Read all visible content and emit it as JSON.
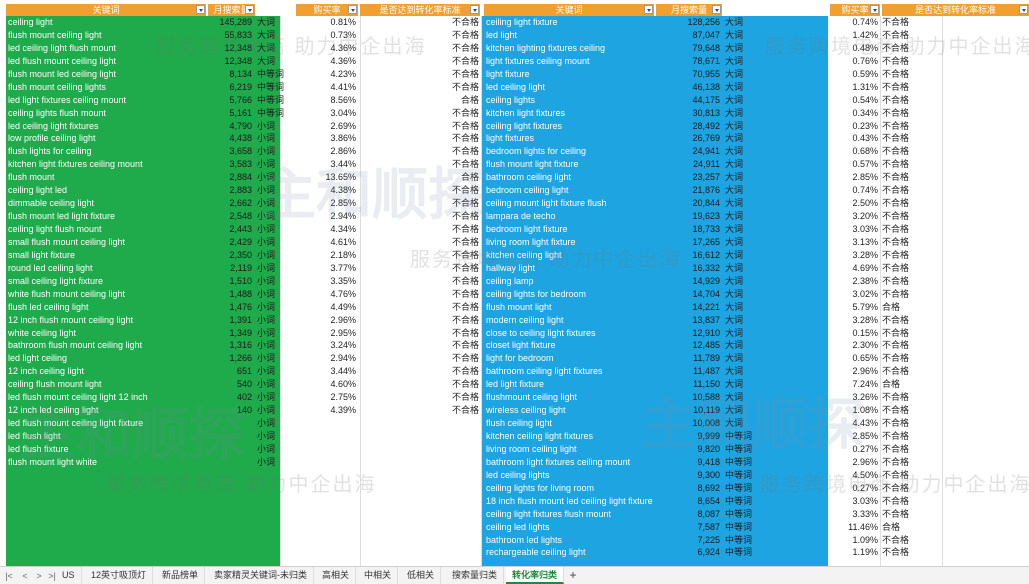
{
  "headers": {
    "keyword": "关键词",
    "monthly_search": "月搜索量",
    "purchase_rate": "购买率",
    "meets_standard": "是否达到转化率标准",
    "keyword_right": "关键词",
    "monthly_search_right": "月搜索量",
    "purchase_rate_right": "购买率",
    "meets_standard_right": "是否达到转化率标准"
  },
  "left_rows": [
    {
      "keyword": "ceiling light",
      "volume": "145,289",
      "category": "大词"
    },
    {
      "keyword": "flush mount ceiling light",
      "volume": "55,833",
      "category": "大词"
    },
    {
      "keyword": "led ceiling light flush mount",
      "volume": "12,348",
      "category": "大词"
    },
    {
      "keyword": "led flush mount ceiling light",
      "volume": "12,348",
      "category": "大词"
    },
    {
      "keyword": "flush mount led ceiling light",
      "volume": "8,134",
      "category": "中等词"
    },
    {
      "keyword": "flush mount ceiling lights",
      "volume": "6,219",
      "category": "中等词"
    },
    {
      "keyword": "led light fixtures ceiling mount",
      "volume": "5,766",
      "category": "中等词"
    },
    {
      "keyword": "ceiling lights flush mount",
      "volume": "5,161",
      "category": "中等词"
    },
    {
      "keyword": "led ceiling light fixtures",
      "volume": "4,790",
      "category": "小词"
    },
    {
      "keyword": "low profile ceiling light",
      "volume": "4,438",
      "category": "小词"
    },
    {
      "keyword": "flush lights for ceiling",
      "volume": "3,658",
      "category": "小词"
    },
    {
      "keyword": "kitchen light fixtures ceiling mount",
      "volume": "3,583",
      "category": "小词"
    },
    {
      "keyword": "flush mount",
      "volume": "2,884",
      "category": "小词"
    },
    {
      "keyword": "ceiling light led",
      "volume": "2,883",
      "category": "小词"
    },
    {
      "keyword": "dimmable ceiling light",
      "volume": "2,662",
      "category": "小词"
    },
    {
      "keyword": "flush mount led light fixture",
      "volume": "2,548",
      "category": "小词"
    },
    {
      "keyword": "ceiling light flush mount",
      "volume": "2,443",
      "category": "小词"
    },
    {
      "keyword": "small flush mount ceiling light",
      "volume": "2,429",
      "category": "小词"
    },
    {
      "keyword": "small light fixture",
      "volume": "2,350",
      "category": "小词"
    },
    {
      "keyword": "round led ceiling light",
      "volume": "2,119",
      "category": "小词"
    },
    {
      "keyword": "small ceiling light fixture",
      "volume": "1,510",
      "category": "小词"
    },
    {
      "keyword": "white flush mount ceiling light",
      "volume": "1,488",
      "category": "小词"
    },
    {
      "keyword": "flush led ceiling light",
      "volume": "1,476",
      "category": "小词"
    },
    {
      "keyword": "12 inch flush mount ceiling light",
      "volume": "1,391",
      "category": "小词"
    },
    {
      "keyword": "white ceiling light",
      "volume": "1,349",
      "category": "小词"
    },
    {
      "keyword": "bathroom flush mount ceiling light",
      "volume": "1,316",
      "category": "小词"
    },
    {
      "keyword": "led light ceiling",
      "volume": "1,266",
      "category": "小词"
    },
    {
      "keyword": "12 inch ceiling light",
      "volume": "651",
      "category": "小词"
    },
    {
      "keyword": "ceiling flush mount light",
      "volume": "540",
      "category": "小词"
    },
    {
      "keyword": "led flush mount ceiling light 12 inch",
      "volume": "402",
      "category": "小词"
    },
    {
      "keyword": "12 inch led ceiling light",
      "volume": "140",
      "category": "小词"
    },
    {
      "keyword": "led flush mount ceiling light fixture",
      "volume": "",
      "category": "小词"
    },
    {
      "keyword": "led flush light",
      "volume": "",
      "category": "小词"
    },
    {
      "keyword": "led flush fixture",
      "volume": "",
      "category": "小词"
    },
    {
      "keyword": "flush mount light white",
      "volume": "",
      "category": "小词"
    }
  ],
  "left_rates": [
    {
      "rate": "0.81%",
      "status": "不合格"
    },
    {
      "rate": "0.73%",
      "status": "不合格"
    },
    {
      "rate": "4.36%",
      "status": "不合格"
    },
    {
      "rate": "4.36%",
      "status": "不合格"
    },
    {
      "rate": "4.23%",
      "status": "不合格"
    },
    {
      "rate": "4.41%",
      "status": "不合格"
    },
    {
      "rate": "8.56%",
      "status": "合格"
    },
    {
      "rate": "3.04%",
      "status": "不合格"
    },
    {
      "rate": "2.69%",
      "status": "不合格"
    },
    {
      "rate": "3.86%",
      "status": "不合格"
    },
    {
      "rate": "2.86%",
      "status": "不合格"
    },
    {
      "rate": "3.44%",
      "status": "不合格"
    },
    {
      "rate": "13.65%",
      "status": "合格"
    },
    {
      "rate": "4.38%",
      "status": "不合格"
    },
    {
      "rate": "2.85%",
      "status": "不合格"
    },
    {
      "rate": "2.94%",
      "status": "不合格"
    },
    {
      "rate": "4.34%",
      "status": "不合格"
    },
    {
      "rate": "4.61%",
      "status": "不合格"
    },
    {
      "rate": "2.18%",
      "status": "不合格"
    },
    {
      "rate": "3.77%",
      "status": "不合格"
    },
    {
      "rate": "3.35%",
      "status": "不合格"
    },
    {
      "rate": "4.76%",
      "status": "不合格"
    },
    {
      "rate": "4.49%",
      "status": "不合格"
    },
    {
      "rate": "2.96%",
      "status": "不合格"
    },
    {
      "rate": "2.95%",
      "status": "不合格"
    },
    {
      "rate": "3.24%",
      "status": "不合格"
    },
    {
      "rate": "2.94%",
      "status": "不合格"
    },
    {
      "rate": "3.44%",
      "status": "不合格"
    },
    {
      "rate": "4.60%",
      "status": "不合格"
    },
    {
      "rate": "2.75%",
      "status": "不合格"
    },
    {
      "rate": "4.39%",
      "status": "不合格"
    }
  ],
  "right_rows": [
    {
      "keyword": "ceiling light fixture",
      "volume": "128,256",
      "category": "大词",
      "rate": "0.74%",
      "status": "不合格"
    },
    {
      "keyword": "led light",
      "volume": "87,047",
      "category": "大词",
      "rate": "1.42%",
      "status": "不合格"
    },
    {
      "keyword": "kitchen lighting fixtures ceiling",
      "volume": "79,648",
      "category": "大词",
      "rate": "0.48%",
      "status": "不合格"
    },
    {
      "keyword": "light fixtures ceiling mount",
      "volume": "78,671",
      "category": "大词",
      "rate": "0.76%",
      "status": "不合格"
    },
    {
      "keyword": "light fixture",
      "volume": "70,955",
      "category": "大词",
      "rate": "0.59%",
      "status": "不合格"
    },
    {
      "keyword": "led ceiling light",
      "volume": "46,138",
      "category": "大词",
      "rate": "1.31%",
      "status": "不合格"
    },
    {
      "keyword": "ceiling lights",
      "volume": "44,175",
      "category": "大词",
      "rate": "0.54%",
      "status": "不合格"
    },
    {
      "keyword": "kitchen light fixtures",
      "volume": "30,813",
      "category": "大词",
      "rate": "0.34%",
      "status": "不合格"
    },
    {
      "keyword": "ceiling light fixtures",
      "volume": "28,492",
      "category": "大词",
      "rate": "0.23%",
      "status": "不合格"
    },
    {
      "keyword": "light fixtures",
      "volume": "26,769",
      "category": "大词",
      "rate": "0.43%",
      "status": "不合格"
    },
    {
      "keyword": "bedroom lights for ceiling",
      "volume": "24,941",
      "category": "大词",
      "rate": "0.68%",
      "status": "不合格"
    },
    {
      "keyword": "flush mount light fixture",
      "volume": "24,911",
      "category": "大词",
      "rate": "0.57%",
      "status": "不合格"
    },
    {
      "keyword": "bathroom ceiling light",
      "volume": "23,257",
      "category": "大词",
      "rate": "2.85%",
      "status": "不合格"
    },
    {
      "keyword": "bedroom ceiling light",
      "volume": "21,876",
      "category": "大词",
      "rate": "0.74%",
      "status": "不合格"
    },
    {
      "keyword": "ceiling mount light fixture flush",
      "volume": "20,844",
      "category": "大词",
      "rate": "2.50%",
      "status": "不合格"
    },
    {
      "keyword": "lampara de techo",
      "volume": "19,623",
      "category": "大词",
      "rate": "3.20%",
      "status": "不合格"
    },
    {
      "keyword": "bedroom light fixture",
      "volume": "18,733",
      "category": "大词",
      "rate": "3.03%",
      "status": "不合格"
    },
    {
      "keyword": "living room light fixture",
      "volume": "17,265",
      "category": "大词",
      "rate": "3.13%",
      "status": "不合格"
    },
    {
      "keyword": "kitchen ceiling light",
      "volume": "16,612",
      "category": "大词",
      "rate": "3.28%",
      "status": "不合格"
    },
    {
      "keyword": "hallway light",
      "volume": "16,332",
      "category": "大词",
      "rate": "4.69%",
      "status": "不合格"
    },
    {
      "keyword": "ceiling lamp",
      "volume": "14,929",
      "category": "大词",
      "rate": "2.38%",
      "status": "不合格"
    },
    {
      "keyword": "ceiling lights for bedroom",
      "volume": "14,704",
      "category": "大词",
      "rate": "3.02%",
      "status": "不合格"
    },
    {
      "keyword": "flush mount light",
      "volume": "14,221",
      "category": "大词",
      "rate": "5.79%",
      "status": "合格"
    },
    {
      "keyword": "modern ceiling light",
      "volume": "13,837",
      "category": "大词",
      "rate": "3.28%",
      "status": "不合格"
    },
    {
      "keyword": "close to ceiling light fixtures",
      "volume": "12,910",
      "category": "大词",
      "rate": "0.15%",
      "status": "不合格"
    },
    {
      "keyword": "closet light fixture",
      "volume": "12,485",
      "category": "大词",
      "rate": "2.30%",
      "status": "不合格"
    },
    {
      "keyword": "light for bedroom",
      "volume": "11,789",
      "category": "大词",
      "rate": "0.65%",
      "status": "不合格"
    },
    {
      "keyword": "bathroom ceiling light fixtures",
      "volume": "11,487",
      "category": "大词",
      "rate": "2.96%",
      "status": "不合格"
    },
    {
      "keyword": "led light fixture",
      "volume": "11,150",
      "category": "大词",
      "rate": "7.24%",
      "status": "合格"
    },
    {
      "keyword": "flushmount ceiling light",
      "volume": "10,588",
      "category": "大词",
      "rate": "3.26%",
      "status": "不合格"
    },
    {
      "keyword": "wireless ceiling light",
      "volume": "10,119",
      "category": "大词",
      "rate": "1.08%",
      "status": "不合格"
    },
    {
      "keyword": "flush ceiling light",
      "volume": "10,008",
      "category": "大词",
      "rate": "4.43%",
      "status": "不合格"
    },
    {
      "keyword": "kitchen ceiling light fixtures",
      "volume": "9,999",
      "category": "中等词",
      "rate": "2.85%",
      "status": "不合格"
    },
    {
      "keyword": "living room ceiling light",
      "volume": "9,820",
      "category": "中等词",
      "rate": "0.27%",
      "status": "不合格"
    },
    {
      "keyword": "bathroom light fixtures ceiling mount",
      "volume": "9,418",
      "category": "中等词",
      "rate": "2.96%",
      "status": "不合格"
    },
    {
      "keyword": "led ceiling lights",
      "volume": "9,300",
      "category": "中等词",
      "rate": "4.50%",
      "status": "不合格"
    },
    {
      "keyword": "ceiling lights for living room",
      "volume": "8,692",
      "category": "中等词",
      "rate": "0.27%",
      "status": "不合格"
    },
    {
      "keyword": "18 inch flush mount led ceiling light fixture",
      "volume": "8,654",
      "category": "中等词",
      "rate": "3.03%",
      "status": "不合格"
    },
    {
      "keyword": "ceiling light fixtures flush mount",
      "volume": "8,087",
      "category": "中等词",
      "rate": "3.33%",
      "status": "不合格"
    },
    {
      "keyword": "ceiling led lights",
      "volume": "7,587",
      "category": "中等词",
      "rate": "11.46%",
      "status": "合格"
    },
    {
      "keyword": "bathroom led lights",
      "volume": "7,225",
      "category": "中等词",
      "rate": "1.09%",
      "status": "不合格"
    },
    {
      "keyword": "rechargeable ceiling light",
      "volume": "6,924",
      "category": "中等词",
      "rate": "1.19%",
      "status": "不合格"
    }
  ],
  "watermark": {
    "text": "服务跨境电商 助力中企出海",
    "logo": "主和顺探"
  },
  "tabs": [
    {
      "label": "US",
      "active": false
    },
    {
      "label": "12英寸吸顶灯",
      "active": false
    },
    {
      "label": "新品榜单",
      "active": false
    },
    {
      "label": "卖家精灵关键词-未归类",
      "active": false
    },
    {
      "label": "高相关",
      "active": false
    },
    {
      "label": "中相关",
      "active": false
    },
    {
      "label": "低相关",
      "active": false
    },
    {
      "label": "搜索量归类",
      "active": false
    },
    {
      "label": "转化率归类",
      "active": true
    }
  ],
  "tab_nav": {
    "first": "|<",
    "prev": "<",
    "next": ">",
    "last": ">|",
    "add": "+"
  },
  "colors": {
    "green_fill": "#1faa4b",
    "blue_fill": "#1ea4e0",
    "header_fill": "#f0a030",
    "active_tab": "#1e8a3c"
  }
}
